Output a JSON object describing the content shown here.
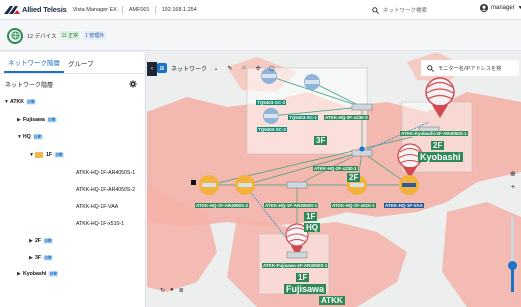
{
  "header": {
    "brand": "Allied Telesis",
    "product": "Vista Manager EX",
    "amf": "AMF001",
    "ip": "192.168.1.254",
    "search_placeholder": "ネットワーク検索",
    "user": "manager"
  },
  "status": {
    "devices": "12 デバイス",
    "normal": "11 正常",
    "managed": "1 管理外"
  },
  "left_panel": {
    "tabs": [
      "ネットワーク階層",
      "グループ"
    ],
    "title": "ネットワーク階層",
    "tree": [
      {
        "label": "ATKK",
        "badge": "自動",
        "arrow": "▼"
      },
      {
        "label": "Fujisawa",
        "badge": "自動",
        "arrow": "▶"
      },
      {
        "label": "HQ",
        "badge": "自動",
        "arrow": "▼"
      },
      {
        "label": "1F",
        "badge": "自動",
        "arrow": "▼"
      },
      {
        "label": "ATKK-HQ-1F-AR4050S-1",
        "badge": "",
        "arrow": ""
      },
      {
        "label": "ATKK-HQ-1F-AR4050S-2",
        "badge": "",
        "arrow": ""
      },
      {
        "label": "ATKK-HQ-1F-VAA",
        "badge": "",
        "arrow": ""
      },
      {
        "label": "ATKK-HQ-1F-x510-1",
        "badge": "",
        "arrow": ""
      },
      {
        "label": "2F",
        "badge": "自動",
        "arrow": "▶"
      },
      {
        "label": "3F",
        "badge": "自動",
        "arrow": "▶"
      },
      {
        "label": "Kyobashi",
        "badge": "自動",
        "arrow": "▶"
      }
    ]
  },
  "map": {
    "toolbar_dropdown": "ネットワーク",
    "search_placeholder": "モニター名/IPアドレスを検",
    "nodes": {
      "sc3": "TQ5403-SC-3",
      "sc1": "TQ5403-SC-1",
      "sc2": "TQ5403-SC-2",
      "hq3f_x230": "ATKK-HQ-3F-x230-3",
      "hq2f_x230": "ATKK-HQ-2F-x230-1",
      "kyobashi_ar": "ATKK-Kyobashi-2F-AR4050S-1",
      "hq1f_ar2": "ATKK-HQ-1F-AR4050S-2",
      "hq1f_ar1": "ATKK-HQ-1F-AR4050S-1",
      "hq1f_x510": "ATKK-HQ-1F-x510-1",
      "hq1f_vaa": "ATKK-HQ-1F-VAA",
      "fujisawa_ar": "ATKK-Fujisawa-1F-AR4050S-1"
    },
    "floor_labels": {
      "f3": "3F",
      "f2": "2F",
      "kyobashi": "Kyobashi",
      "f1": "1F",
      "hq": "HQ",
      "fujisawa_1f": "1F",
      "fujisawa": "Fujisawa",
      "atkk": "ATKK"
    }
  },
  "colors": {
    "accent": "#1a73c7",
    "ok": "#2e8b57",
    "node_label": "#2e8b57",
    "map_red": "#f4b1a8"
  }
}
